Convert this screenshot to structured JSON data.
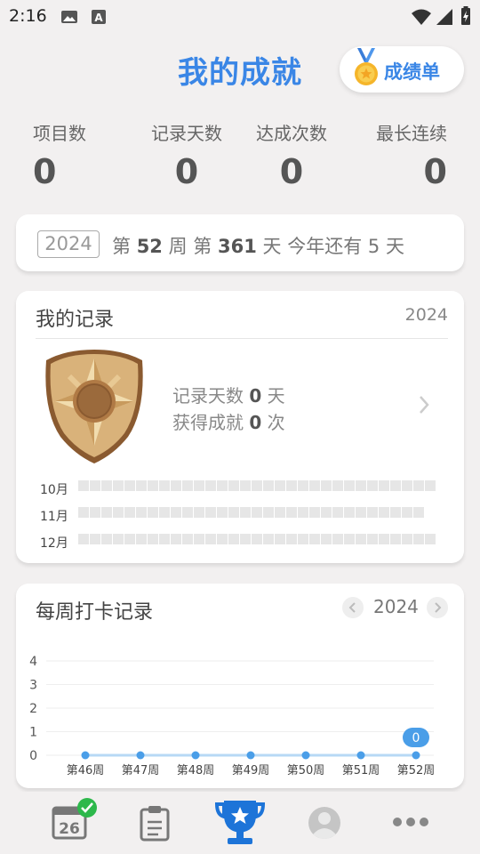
{
  "status_bar": {
    "time": "2:16",
    "icons": [
      "image-icon",
      "a-icon",
      "wifi-icon",
      "signal-icon",
      "battery-charging-icon"
    ]
  },
  "header": {
    "title": "我的成就",
    "report_button": "成绩单",
    "report_icon": "medal-icon"
  },
  "stats": [
    {
      "label": "项目数",
      "value": "0"
    },
    {
      "label": "记录天数",
      "value": "0"
    },
    {
      "label": "达成次数",
      "value": "0"
    },
    {
      "label": "最长连续",
      "value": "0"
    }
  ],
  "week_info": {
    "year": "2024",
    "prefix": "第",
    "week": "52",
    "week_unit": "周",
    "day_prefix": "第",
    "day": "361",
    "day_unit": "天",
    "remaining_prefix": "今年还有",
    "remaining": "5",
    "remaining_unit": "天"
  },
  "records": {
    "title": "我的记录",
    "year": "2024",
    "days_label": "记录天数",
    "days_value": "0",
    "days_unit": "天",
    "achievements_label": "获得成就",
    "achievements_value": "0",
    "achievements_unit": "次",
    "months": [
      {
        "label": "10月",
        "days": 31
      },
      {
        "label": "11月",
        "days": 30
      },
      {
        "label": "12月",
        "days": 31
      }
    ]
  },
  "weekly_chart": {
    "title": "每周打卡记录",
    "year": "2024",
    "tooltip": "0"
  },
  "chart_data": {
    "type": "line",
    "title": "每周打卡记录",
    "categories": [
      "第46周",
      "第47周",
      "第48周",
      "第49周",
      "第50周",
      "第51周",
      "第52周"
    ],
    "values": [
      0,
      0,
      0,
      0,
      0,
      0,
      0
    ],
    "yticks": [
      "0",
      "1",
      "2",
      "3",
      "4"
    ],
    "ylim": [
      0,
      4
    ],
    "grid": true,
    "color": "#4a9ee8"
  },
  "bottom_nav": [
    {
      "name": "calendar",
      "label": "26",
      "active": false
    },
    {
      "name": "clipboard",
      "active": false
    },
    {
      "name": "trophy",
      "active": true
    },
    {
      "name": "profile",
      "active": false
    },
    {
      "name": "more",
      "active": false
    }
  ],
  "colors": {
    "accent": "#3a86e6",
    "check_badge": "#2db84b",
    "bronze": "#b07a45"
  }
}
